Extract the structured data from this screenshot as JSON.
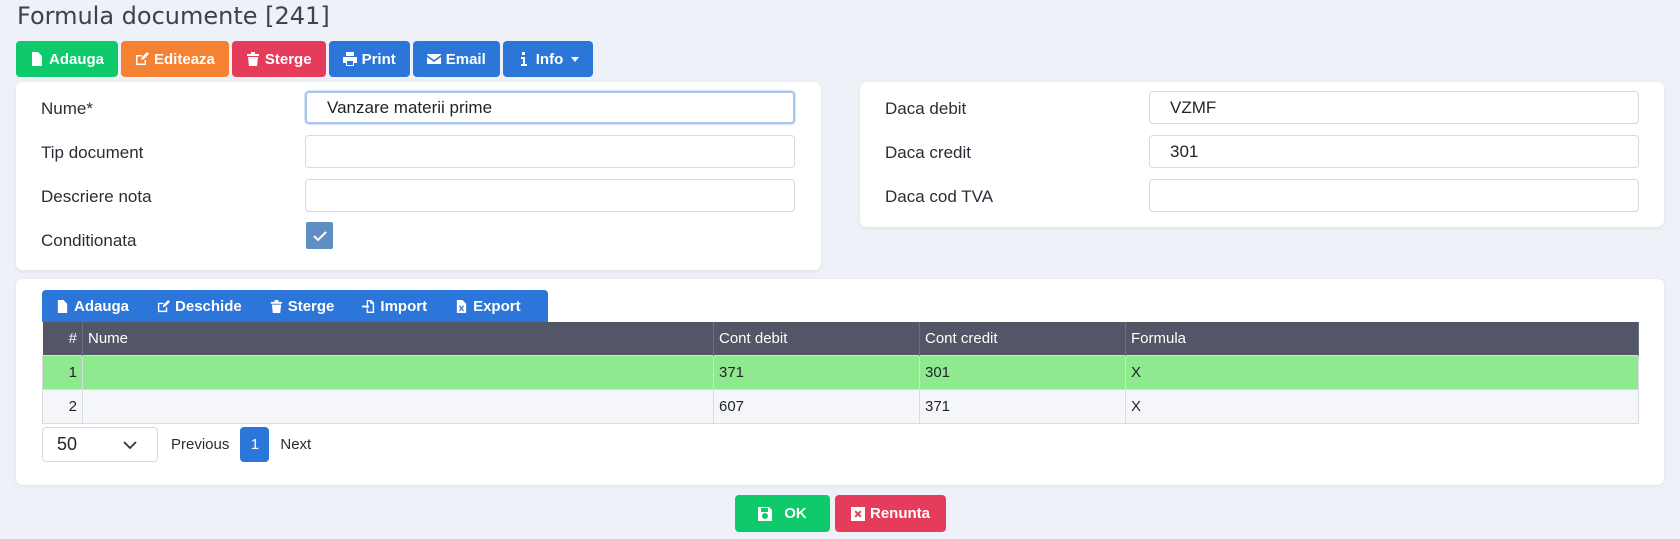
{
  "page": {
    "title": "Formula documente [241]"
  },
  "toolbar": {
    "add": "Adauga",
    "edit": "Editeaza",
    "delete": "Sterge",
    "print": "Print",
    "email": "Email",
    "info": "Info"
  },
  "form_left": {
    "name_label": "Nume*",
    "name_value": "Vanzare materii prime",
    "doc_type_label": "Tip document",
    "doc_type_value": "",
    "note_label": "Descriere nota",
    "note_value": "",
    "conditional_label": "Conditionata",
    "conditional_checked": true
  },
  "form_right": {
    "debit_label": "Daca debit",
    "debit_value": "VZMF",
    "credit_label": "Daca credit",
    "credit_value": "301",
    "vat_label": "Daca cod TVA",
    "vat_value": ""
  },
  "grid_toolbar": {
    "add": "Adauga",
    "open": "Deschide",
    "delete": "Sterge",
    "import": "Import",
    "export": "Export"
  },
  "grid": {
    "columns": [
      "#",
      "Nume",
      "Cont debit",
      "Cont credit",
      "Formula"
    ],
    "rows": [
      [
        "1",
        "",
        "371",
        "301",
        "X"
      ],
      [
        "2",
        "",
        "607",
        "371",
        "X"
      ]
    ]
  },
  "pager": {
    "page_size": "50",
    "previous": "Previous",
    "current": "1",
    "next": "Next"
  },
  "footer": {
    "ok": "OK",
    "cancel": "Renunta"
  },
  "colors": {
    "green": "#0fca6b",
    "orange": "#f48232",
    "red": "#e63c5c",
    "blue": "#2d76d9",
    "header": "#525666",
    "selected_row": "#8fe98f"
  }
}
